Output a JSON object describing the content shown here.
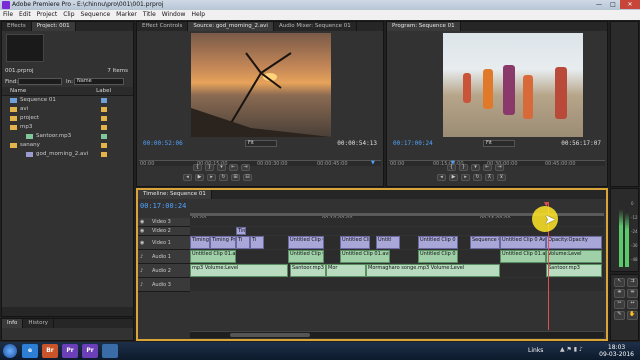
{
  "window": {
    "title": "Adobe Premiere Pro - E:\\chinnu\\pro\\001\\001.prproj",
    "min": "—",
    "max": "□",
    "close": "✕"
  },
  "menu": [
    "File",
    "Edit",
    "Project",
    "Clip",
    "Sequence",
    "Marker",
    "Title",
    "Window",
    "Help"
  ],
  "project_panel": {
    "tabs": [
      "Effects",
      "Project: 001"
    ],
    "project_file": "001.prproj",
    "item_count": "7 Items",
    "find_label": "Find:",
    "in_label": "In:",
    "in_value": "Name",
    "columns": {
      "name": "Name",
      "label": "Label"
    },
    "items": [
      {
        "name": "Sequence 01",
        "type": "sequence",
        "color": "#6fa0d8"
      },
      {
        "name": "avi",
        "type": "bin",
        "color": "#e3b44a"
      },
      {
        "name": "project",
        "type": "bin",
        "color": "#e3b44a"
      },
      {
        "name": "mp3",
        "type": "bin",
        "color": "#e3b44a"
      },
      {
        "name": "Santoor.mp3",
        "type": "audio",
        "color": "#7fc79a"
      },
      {
        "name": "sanany",
        "type": "bin",
        "color": "#e3b44a"
      },
      {
        "name": "god_morning_2.avi",
        "type": "video",
        "color": "#e3b44a"
      }
    ],
    "bottom_tabs": [
      "Info",
      "History"
    ]
  },
  "source_monitor": {
    "tabs": [
      "Effect Controls",
      "Source: god_morning_2.avi",
      "Audio Mixer: Sequence 01"
    ],
    "timecode_in": "00:00:52:06",
    "fit": "Fit",
    "timecode_dur": "00:00:54:13",
    "ruler": [
      "00:00",
      "00:00:15:00",
      "00:00:30:00",
      "00:00:45:00"
    ]
  },
  "program_monitor": {
    "tab": "Program: Sequence 01",
    "timecode_in": "00:17:00:24",
    "fit": "Fit",
    "timecode_dur": "00:56:17:07",
    "ruler": [
      "00:00",
      "00:15:00:00",
      "00:30:00:00",
      "00:45:00:00"
    ]
  },
  "timeline": {
    "tab": "Timeline: Sequence 01",
    "timecode": "00:17:00:24",
    "ruler": [
      "00:00",
      "00:10:00:00",
      "00:15:00:00"
    ],
    "tracks": [
      {
        "name": "Video 3",
        "kind": "video"
      },
      {
        "name": "Video 2",
        "kind": "video"
      },
      {
        "name": "Video 1",
        "kind": "video"
      },
      {
        "name": "Audio 1",
        "kind": "audio"
      },
      {
        "name": "Audio 2",
        "kind": "audio"
      },
      {
        "name": "Audio 3",
        "kind": "audio"
      }
    ],
    "v2_clips": [
      "Tin"
    ],
    "v1_clips": [
      "Timing",
      "Timing Pro",
      "Ti",
      "Ti",
      "Untitled Clip 0",
      "Untitled Clip 0",
      "Untitl",
      "Untitled Clip 0",
      "Sequence 0",
      "Untitled Clip 0 Avi",
      "Opacity:Opacity"
    ],
    "a1_clips": [
      "Untitled Clip 01.avi",
      "Untitled Clip 0",
      "Untitled Clip 01.avi",
      "Untitled Clip 0",
      "Untitled Clip 01.avi",
      "Volume:Level"
    ],
    "a2_clips": [
      "mp3  Volume:Level",
      "Santoor.mp3",
      "Mor",
      "Mormagharo songe.mp3  Volume:Level",
      "Santoor.mp3"
    ]
  },
  "audio_meter": {
    "labels": [
      "0",
      "-12",
      "-24",
      "-36",
      "-48"
    ]
  },
  "taskbar": {
    "apps": [
      {
        "label": "e",
        "color": "#2d7fd6"
      },
      {
        "label": "Br",
        "color": "#c9542a"
      },
      {
        "label": "Pr",
        "color": "#6a3fb8"
      },
      {
        "label": "Pr",
        "color": "#6a3fb8"
      },
      {
        "label": "",
        "color": "#3a6da8"
      }
    ],
    "links": "Links",
    "time": "18:03",
    "date": "09-03-2016"
  }
}
